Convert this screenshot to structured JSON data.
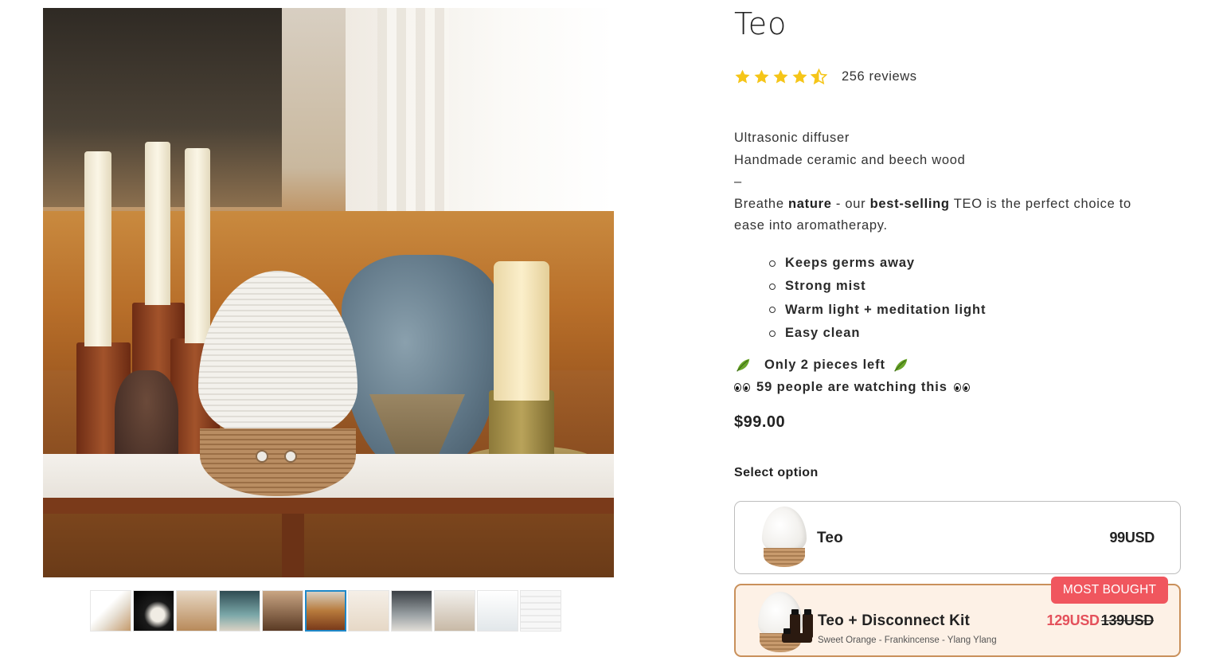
{
  "product": {
    "title": "Teo",
    "rating": 4.5,
    "rating_max": 5,
    "reviews_text": "256 reviews",
    "description": {
      "line1": "Ultrasonic diffuser",
      "line2": "Handmade ceramic and beech wood",
      "dash": "–",
      "p_a": "Breathe ",
      "p_b": "nature",
      "p_c": " - our ",
      "p_d": "best-selling",
      "p_e": " TEO is the perfect choice to",
      "p_f": "ease into aromatherapy."
    },
    "features": [
      "Keeps germs away",
      "Strong mist",
      "Warm light + meditation light",
      "Easy clean"
    ],
    "stock_text": "Only 2 pieces left",
    "watching_text": "59 people are watching this",
    "price": "$99.00",
    "select_label": "Select option"
  },
  "options": [
    {
      "name": "Teo",
      "price": "99USD"
    },
    {
      "name": "Teo + Disconnect Kit",
      "sub": "Sweet Orange - Frankincense - Ylang Ylang",
      "sale_price": "129USD",
      "old_price": "139USD",
      "badge": "MOST BOUGHT"
    }
  ],
  "gallery": {
    "thumb_count": 11,
    "active_index": 5
  },
  "colors": {
    "star": "#f5c518",
    "badge": "#f0565e",
    "sale": "#e4515b",
    "selected_border": "#c9905b",
    "selected_bg": "#fdf1e6",
    "thumb_active": "#1e88c8",
    "leaf": "#6aa52a"
  },
  "icons": {
    "star": "star-icon",
    "half_star": "half-star-icon",
    "leaf": "leaf-icon",
    "eyes": "eyes-icon"
  }
}
